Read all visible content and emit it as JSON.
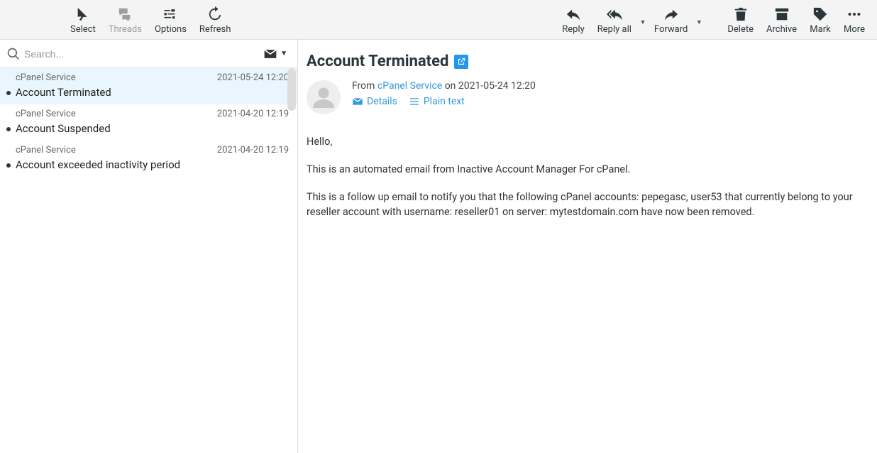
{
  "toolbar": {
    "left": [
      {
        "id": "select",
        "label": "Select",
        "svg": "cursor"
      },
      {
        "id": "threads",
        "label": "Threads",
        "svg": "comments",
        "disabled": true
      },
      {
        "id": "options",
        "label": "Options",
        "svg": "sliders"
      },
      {
        "id": "refresh",
        "label": "Refresh",
        "svg": "refresh"
      }
    ],
    "right": [
      {
        "id": "reply",
        "label": "Reply",
        "svg": "reply"
      },
      {
        "id": "replyall",
        "label": "Reply all",
        "svg": "replyall",
        "dropdown": true
      },
      {
        "id": "forward",
        "label": "Forward",
        "svg": "forward",
        "dropdown": true
      },
      {
        "id": "delete",
        "label": "Delete",
        "svg": "trash",
        "pad": true
      },
      {
        "id": "archive",
        "label": "Archive",
        "svg": "archive"
      },
      {
        "id": "mark",
        "label": "Mark",
        "svg": "tag"
      },
      {
        "id": "more",
        "label": "More",
        "svg": "dots"
      }
    ]
  },
  "search": {
    "placeholder": "Search..."
  },
  "threads": [
    {
      "from": "cPanel Service",
      "date": "2021-05-24 12:20",
      "subject": "Account Terminated",
      "unread": true,
      "selected": true
    },
    {
      "from": "cPanel Service",
      "date": "2021-04-20 12:19",
      "subject": "Account Suspended",
      "unread": true
    },
    {
      "from": "cPanel Service",
      "date": "2021-04-20 12:19",
      "subject": "Account exceeded inactivity period",
      "unread": true
    }
  ],
  "message": {
    "subject": "Account Terminated",
    "from_label": "From",
    "sender": "cPanel Service",
    "on": "on",
    "datetime": "2021-05-24 12:20",
    "details_label": "Details",
    "plaintext_label": "Plain text",
    "paragraphs": [
      "Hello,",
      "This is an automated email from Inactive Account Manager For cPanel.",
      "This is a follow up email to notify you that the following cPanel accounts: pepegasc, user53 that currently belong to your reseller account with username: reseller01 on server: mytestdomain.com have now been removed."
    ]
  }
}
